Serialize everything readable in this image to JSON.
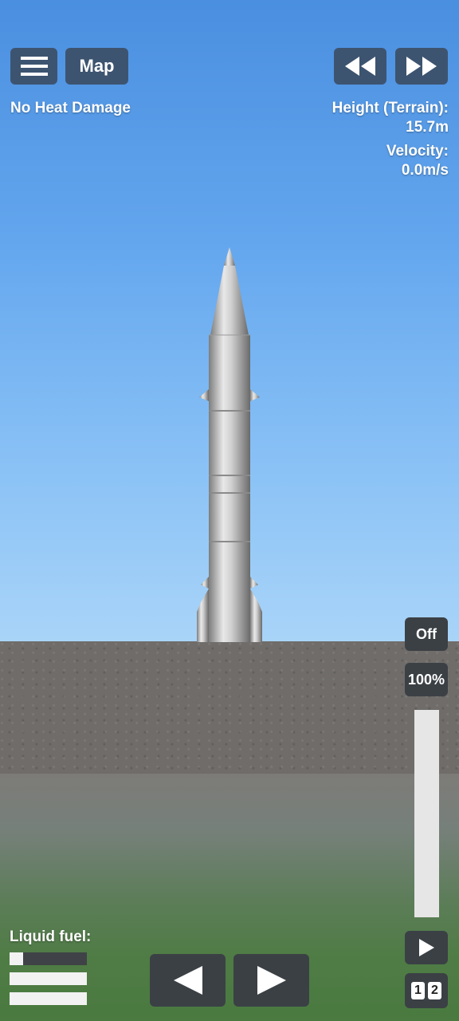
{
  "menu": {
    "icon": "hamburger-menu-icon",
    "map_label": "Map"
  },
  "time_controls": {
    "rewind_icon": "rewind-icon",
    "fast_forward_icon": "fast-forward-icon"
  },
  "status": {
    "heat": "No Heat Damage"
  },
  "telemetry": {
    "height_label": "Height (Terrain):",
    "height_value": "15.7m",
    "velocity_label": "Velocity:",
    "velocity_value": "0.0m/s"
  },
  "throttle": {
    "toggle_label": "Off",
    "percent_label": "100%",
    "level": 1.0
  },
  "fuel": {
    "label": "Liquid fuel:",
    "bars": [
      0.18,
      1.0,
      1.0
    ]
  },
  "controls": {
    "rotate_left_icon": "rotate-left-icon",
    "rotate_right_icon": "rotate-right-icon",
    "activate_stage_icon": "play-stage-icon"
  },
  "stages": [
    "1",
    "2"
  ],
  "colors": {
    "button": "#3d5470",
    "dark_button": "#3b4045",
    "sky_top": "#4a8fe0",
    "ground": "#6f6c69"
  }
}
